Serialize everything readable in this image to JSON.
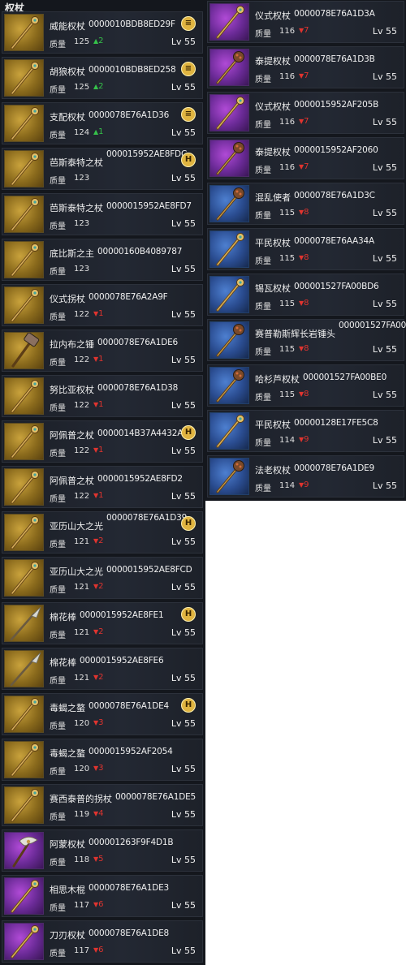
{
  "section_title": "权杖",
  "quality_label": "质量",
  "colors": {
    "up": "#35c24a",
    "down": "#e0342f",
    "badge": "#e0b440",
    "panel": "#14171d"
  },
  "left_items": [
    {
      "name": "威能权杖",
      "code": "0000010BDB8ED29F",
      "quality": "125",
      "delta": "2",
      "dir": "up",
      "level": "Lv 55",
      "badge": "≡",
      "frame": "gold",
      "icon": "staff-icon"
    },
    {
      "name": "胡狼权杖",
      "code": "0000010BDB8ED258",
      "quality": "125",
      "delta": "2",
      "dir": "up",
      "level": "Lv 55",
      "badge": "≡",
      "frame": "gold",
      "icon": "staff-icon"
    },
    {
      "name": "支配权杖",
      "code": "0000078E76A1D36",
      "quality": "124",
      "delta": "1",
      "dir": "up",
      "level": "Lv 55",
      "badge": "≡",
      "frame": "gold",
      "icon": "staff-icon"
    },
    {
      "name": "芭斯泰特之杖",
      "code": "000015952AE8FDC",
      "quality": "123",
      "delta": "",
      "dir": "",
      "level": "Lv 55",
      "badge": "H",
      "frame": "gold",
      "icon": "staff-icon",
      "code_high": true
    },
    {
      "name": "芭斯泰特之杖",
      "code": "0000015952AE8FD7",
      "quality": "123",
      "delta": "",
      "dir": "",
      "level": "Lv 55",
      "badge": "",
      "frame": "gold",
      "icon": "staff-icon"
    },
    {
      "name": "底比斯之主",
      "code": "00000160B4089787",
      "quality": "123",
      "delta": "",
      "dir": "",
      "level": "Lv 55",
      "badge": "",
      "frame": "gold",
      "icon": "staff-icon"
    },
    {
      "name": "仪式拐杖",
      "code": "0000078E76A2A9F",
      "quality": "122",
      "delta": "1",
      "dir": "down",
      "level": "Lv 55",
      "badge": "",
      "frame": "gold",
      "icon": "staff-icon"
    },
    {
      "name": "拉内布之锤",
      "code": "0000078E76A1DE6",
      "quality": "122",
      "delta": "1",
      "dir": "down",
      "level": "Lv 55",
      "badge": "",
      "frame": "gold",
      "icon": "hammer-icon"
    },
    {
      "name": "努比亚权杖",
      "code": "0000078E76A1D38",
      "quality": "122",
      "delta": "1",
      "dir": "down",
      "level": "Lv 55",
      "badge": "",
      "frame": "gold",
      "icon": "staff-icon"
    },
    {
      "name": "阿佩普之杖",
      "code": "0000014B37A4432A",
      "quality": "122",
      "delta": "1",
      "dir": "down",
      "level": "Lv 55",
      "badge": "H",
      "frame": "gold",
      "icon": "staff-icon"
    },
    {
      "name": "阿佩普之杖",
      "code": "0000015952AE8FD2",
      "quality": "122",
      "delta": "1",
      "dir": "down",
      "level": "Lv 55",
      "badge": "",
      "frame": "gold",
      "icon": "staff-icon"
    },
    {
      "name": "亚历山大之光",
      "code": "0000078E76A1D39",
      "quality": "121",
      "delta": "2",
      "dir": "down",
      "level": "Lv 55",
      "badge": "H",
      "frame": "gold",
      "icon": "staff-icon",
      "code_high": true
    },
    {
      "name": "亚历山大之光",
      "code": "0000015952AE8FCD",
      "quality": "121",
      "delta": "2",
      "dir": "down",
      "level": "Lv 55",
      "badge": "",
      "frame": "gold",
      "icon": "staff-icon"
    },
    {
      "name": "棉花棒",
      "code": "0000015952AE8FE1",
      "quality": "121",
      "delta": "2",
      "dir": "down",
      "level": "Lv 55",
      "badge": "H",
      "frame": "gold",
      "icon": "spear-icon"
    },
    {
      "name": "棉花棒",
      "code": "0000015952AE8FE6",
      "quality": "121",
      "delta": "2",
      "dir": "down",
      "level": "Lv 55",
      "badge": "",
      "frame": "gold",
      "icon": "spear-icon"
    },
    {
      "name": "毒蝎之螯",
      "code": "0000078E76A1DE4",
      "quality": "120",
      "delta": "3",
      "dir": "down",
      "level": "Lv 55",
      "badge": "H",
      "frame": "gold",
      "icon": "staff-icon"
    },
    {
      "name": "毒蝎之螯",
      "code": "0000015952AF2054",
      "quality": "120",
      "delta": "3",
      "dir": "down",
      "level": "Lv 55",
      "badge": "",
      "frame": "gold",
      "icon": "staff-icon"
    },
    {
      "name": "赛西泰普的拐杖",
      "code": "0000078E76A1DE5",
      "quality": "119",
      "delta": "4",
      "dir": "down",
      "level": "Lv 55",
      "badge": "",
      "frame": "gold",
      "icon": "staff-icon"
    },
    {
      "name": "阿蒙权杖",
      "code": "000001263F9F4D1B",
      "quality": "118",
      "delta": "5",
      "dir": "down",
      "level": "Lv 55",
      "badge": "",
      "frame": "purple",
      "icon": "axe-icon"
    },
    {
      "name": "相思木棍",
      "code": "0000078E76A1DE3",
      "quality": "117",
      "delta": "6",
      "dir": "down",
      "level": "Lv 55",
      "badge": "",
      "frame": "purple",
      "icon": "staff-icon"
    },
    {
      "name": "刀刃权杖",
      "code": "0000078E76A1DE8",
      "quality": "117",
      "delta": "6",
      "dir": "down",
      "level": "Lv 55",
      "badge": "",
      "frame": "purple",
      "icon": "staff-icon"
    }
  ],
  "right_items": [
    {
      "name": "仪式权杖",
      "code": "0000078E76A1D3A",
      "quality": "116",
      "delta": "7",
      "dir": "down",
      "level": "Lv 55",
      "badge": "",
      "frame": "purple",
      "icon": "staff-icon"
    },
    {
      "name": "泰提权杖",
      "code": "0000078E76A1D3B",
      "quality": "116",
      "delta": "7",
      "dir": "down",
      "level": "Lv 55",
      "badge": "",
      "frame": "purple",
      "icon": "mace-icon"
    },
    {
      "name": "仪式权杖",
      "code": "0000015952AF205B",
      "quality": "116",
      "delta": "7",
      "dir": "down",
      "level": "Lv 55",
      "badge": "",
      "frame": "purple",
      "icon": "staff-icon"
    },
    {
      "name": "泰提权杖",
      "code": "0000015952AF2060",
      "quality": "116",
      "delta": "7",
      "dir": "down",
      "level": "Lv 55",
      "badge": "",
      "frame": "purple",
      "icon": "mace-icon"
    },
    {
      "name": "混乱使者",
      "code": "0000078E76A1D3C",
      "quality": "115",
      "delta": "8",
      "dir": "down",
      "level": "Lv 55",
      "badge": "",
      "frame": "blue",
      "icon": "mace-icon"
    },
    {
      "name": "平民权杖",
      "code": "0000078E76AA34A",
      "quality": "115",
      "delta": "8",
      "dir": "down",
      "level": "Lv 55",
      "badge": "",
      "frame": "blue",
      "icon": "staff-icon"
    },
    {
      "name": "锡瓦权杖",
      "code": "000001527FA00BD6",
      "quality": "115",
      "delta": "8",
      "dir": "down",
      "level": "Lv 55",
      "badge": "",
      "frame": "blue",
      "icon": "staff-icon"
    },
    {
      "name": "赛普勒斯辉长岩锤头",
      "code": "000001527FA00BDB",
      "quality": "115",
      "delta": "8",
      "dir": "down",
      "level": "Lv 55",
      "badge": "",
      "frame": "blue",
      "icon": "mace-icon",
      "code_high": true
    },
    {
      "name": "哈杉芦权杖",
      "code": "000001527FA00BE0",
      "quality": "115",
      "delta": "8",
      "dir": "down",
      "level": "Lv 55",
      "badge": "",
      "frame": "blue",
      "icon": "mace-icon"
    },
    {
      "name": "平民权杖",
      "code": "00000128E17FE5C8",
      "quality": "114",
      "delta": "9",
      "dir": "down",
      "level": "Lv 55",
      "badge": "",
      "frame": "blue",
      "icon": "staff-icon"
    },
    {
      "name": "法老权杖",
      "code": "0000078E76A1DE9",
      "quality": "114",
      "delta": "9",
      "dir": "down",
      "level": "Lv 55",
      "badge": "",
      "frame": "blue",
      "icon": "mace-icon"
    }
  ]
}
